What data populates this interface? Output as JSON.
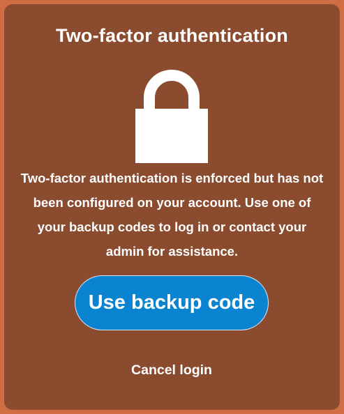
{
  "dialog": {
    "title": "Two-factor authentication",
    "icon": "lock-icon",
    "message": "Two-factor authentication is enforced but has not been configured on your account. Use one of your backup codes to log in or contact your admin for assistance.",
    "primary_button_label": "Use backup code",
    "secondary_button_label": "Cancel login"
  },
  "colors": {
    "page_background": "#d06d43",
    "card_background": "#8b4b2f",
    "primary_button": "#0a84d0",
    "text": "#ffffff"
  }
}
